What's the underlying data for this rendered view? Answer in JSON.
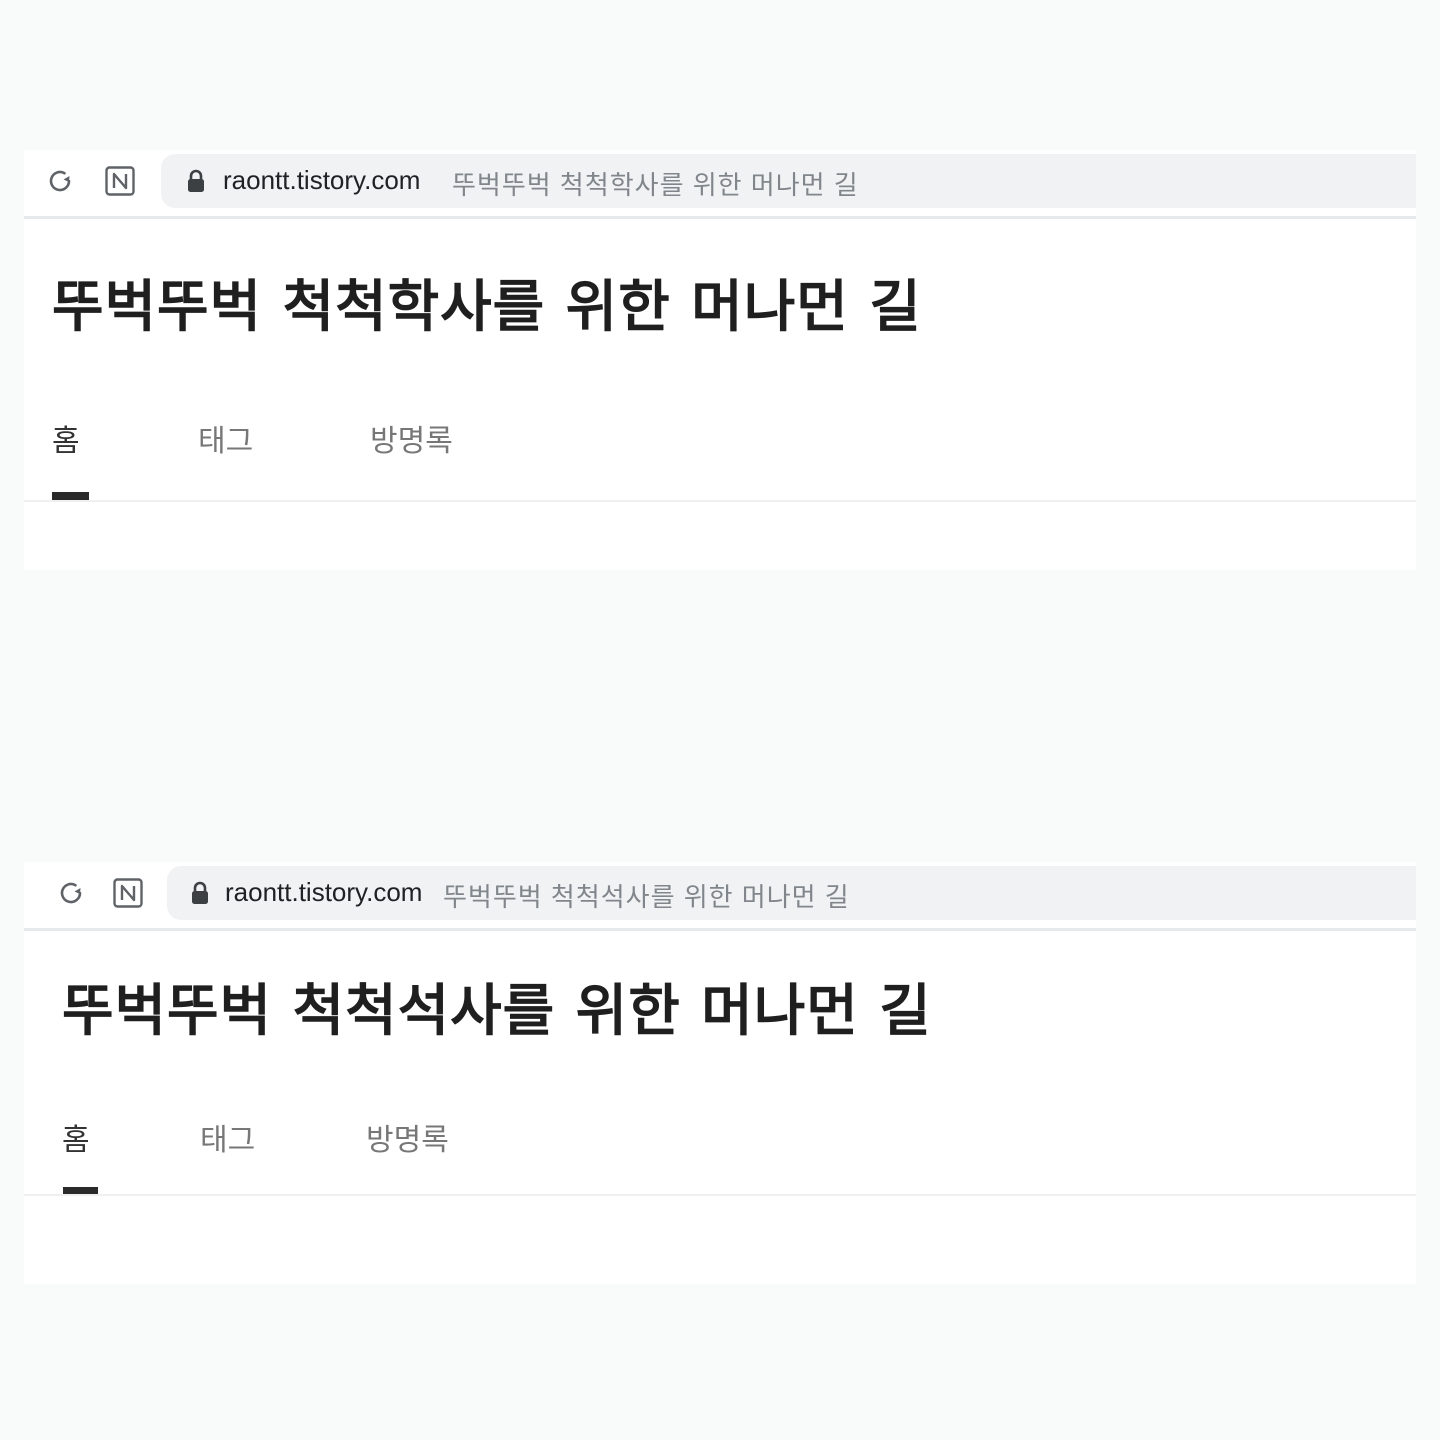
{
  "screenshots": [
    {
      "browser": {
        "domain": "raontt.tistory.com",
        "tab_title": "뚜벅뚜벅 척척학사를 위한 머나먼 길",
        "icons": [
          "reload-icon",
          "naver-n-icon",
          "lock-icon"
        ]
      },
      "blog": {
        "title": "뚜벅뚜벅 척척학사를 위한 머나먼 길",
        "nav": [
          {
            "label": "홈",
            "active": true
          },
          {
            "label": "태그",
            "active": false
          },
          {
            "label": "방명록",
            "active": false
          }
        ]
      }
    },
    {
      "browser": {
        "domain": "raontt.tistory.com",
        "tab_title": "뚜벅뚜벅 척척석사를 위한 머나먼 길",
        "icons": [
          "reload-icon",
          "naver-n-icon",
          "lock-icon"
        ]
      },
      "blog": {
        "title": "뚜벅뚜벅 척척석사를 위한 머나먼 길",
        "nav": [
          {
            "label": "홈",
            "active": true
          },
          {
            "label": "태그",
            "active": false
          },
          {
            "label": "방명록",
            "active": false
          }
        ]
      }
    }
  ],
  "colors": {
    "background": "#f9fafa",
    "urlbar": "#f0f2f4",
    "title_text": "#1f1f1f",
    "nav_active_underline": "#2a2a2a",
    "url_title_text": "#80868b"
  }
}
